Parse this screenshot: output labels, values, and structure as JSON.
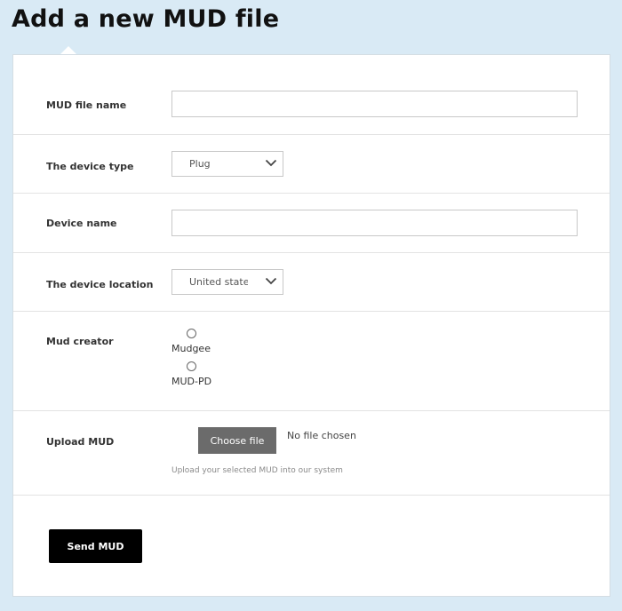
{
  "page": {
    "title": "Add a new MUD file"
  },
  "form": {
    "mud_file_name": {
      "label": "MUD file name",
      "value": ""
    },
    "device_type": {
      "label": "The device type",
      "selected": "Plug"
    },
    "device_name": {
      "label": "Device name",
      "value": ""
    },
    "device_location": {
      "label": "The device location",
      "selected": "United states"
    },
    "mud_creator": {
      "label": "Mud creator",
      "options": [
        {
          "label": "Mudgee",
          "checked": false
        },
        {
          "label": "MUD-PD",
          "checked": false
        }
      ]
    },
    "upload": {
      "label": "Upload MUD",
      "button_label": "Choose file",
      "status": "No file chosen",
      "help": "Upload your selected MUD into our system"
    },
    "submit_label": "Send MUD"
  },
  "icons": {
    "select_chevron": "chevron-down-icon",
    "radio": "radio-button"
  },
  "colors": {
    "page_background": "#d9eaf5",
    "card_background": "#ffffff",
    "submit_background": "#000000",
    "choose_file_background": "#6b6b6b"
  }
}
